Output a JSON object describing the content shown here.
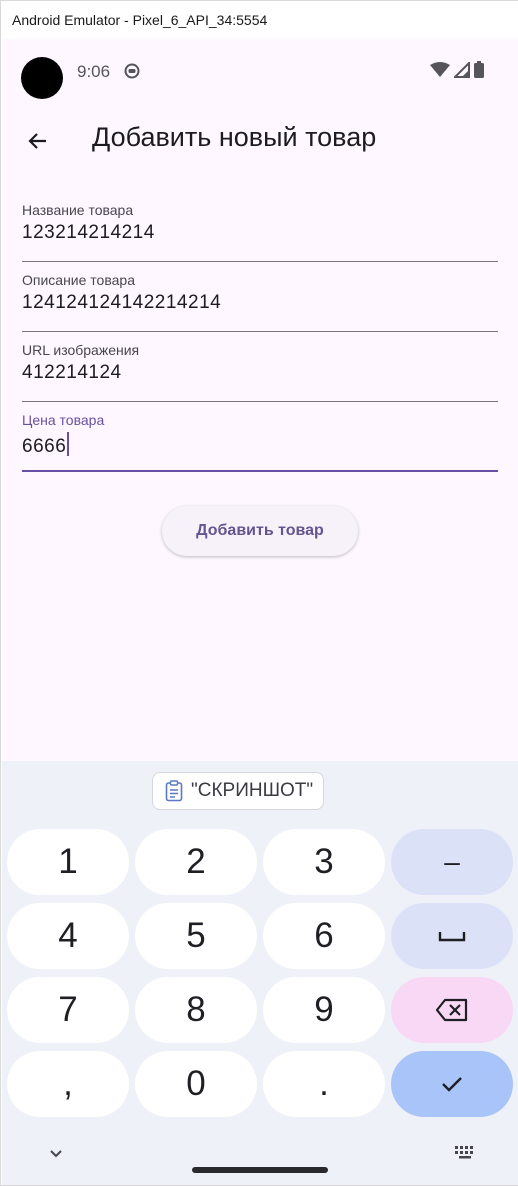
{
  "window": {
    "title": "Android Emulator - Pixel_6_API_34:5554"
  },
  "status_bar": {
    "time": "9:06",
    "icons": [
      "camera-cutout",
      "app-notification-icon",
      "wifi-icon",
      "signal-icon",
      "battery-icon"
    ]
  },
  "app_bar": {
    "back_icon": "arrow-back-icon",
    "title": "Добавить новый товар"
  },
  "form": {
    "fields": [
      {
        "label": "Название товара",
        "value": "123214214214"
      },
      {
        "label": "Описание товара",
        "value": "124124124142214214"
      },
      {
        "label": "URL изображения",
        "value": "412214124"
      },
      {
        "label": "Цена товара",
        "value": "6666"
      }
    ],
    "submit_label": "Добавить товар"
  },
  "keyboard": {
    "suggestion": "\"СКРИНШОТ\"",
    "keys": [
      "1",
      "2",
      "3",
      "–",
      "4",
      "5",
      "6",
      "7",
      "8",
      "9",
      ",",
      "0",
      "."
    ],
    "special_icons": [
      "space-icon",
      "backspace-icon",
      "check-icon",
      "chevron-down-icon",
      "keyboard-icon"
    ]
  },
  "colors": {
    "accent": "#6750a4",
    "background": "#fef7ff",
    "keyboard_bg": "#eff1f8",
    "ok_key": "#a8c4f8",
    "delete_key": "#f8d8f4"
  }
}
